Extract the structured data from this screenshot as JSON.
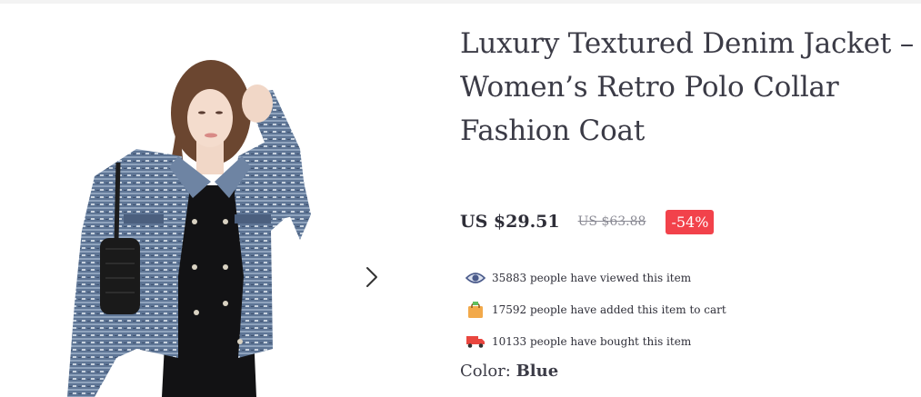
{
  "product": {
    "title": "Luxury Textured Denim Jacket – Women’s Retro Polo Collar Fashion Coat",
    "price": "US $29.51",
    "original_price": "US $63.88",
    "discount": "-54%"
  },
  "stats": {
    "viewed": "35883 people have viewed this item",
    "added_to_cart": "17592 people have added this item to cart",
    "bought": "10133 people have bought this item"
  },
  "color": {
    "label": "Color: ",
    "value": "Blue"
  },
  "colors": {
    "discount_bg": "#f2424b",
    "jacket": "#5e7595",
    "eye_icon": "#4a5a8a",
    "cart_icon": "#f2a94a",
    "truck_icon": "#e9463f"
  },
  "icons": [
    "chevron-right-icon",
    "eye-icon",
    "shopping-bag-icon",
    "delivery-truck-icon"
  ]
}
